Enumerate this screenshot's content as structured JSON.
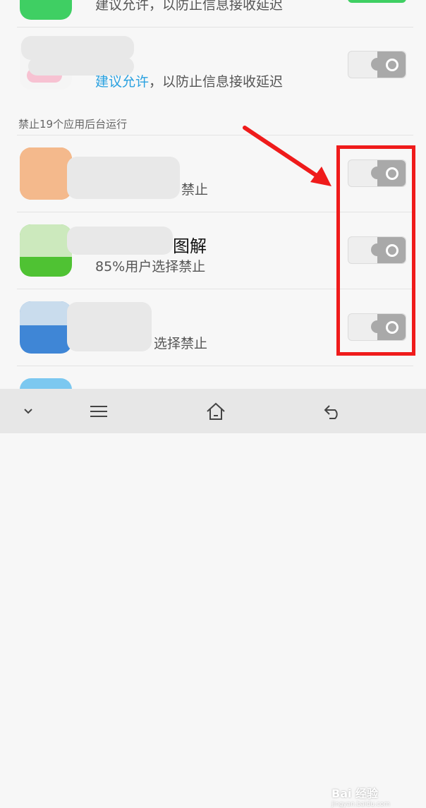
{
  "apps": [
    {
      "subtitle": "建议允许，以防止信息接收延迟",
      "toggle_on": true
    },
    {
      "subtitle_link": "建议允许",
      "subtitle_rest": "，以防止信息接收延迟",
      "toggle_on": false
    }
  ],
  "section": {
    "header": "禁止19个应用后台运行"
  },
  "blocked": [
    {
      "title": "",
      "subtitle": "禁止",
      "toggle_on": false
    },
    {
      "title": "图解",
      "subtitle": "85%用户选择禁止",
      "toggle_on": false
    },
    {
      "title": "",
      "subtitle": "选择禁止",
      "toggle_on": false
    }
  ],
  "navbar": {
    "icons": [
      "chevron-down-icon",
      "menu-icon",
      "home-icon",
      "back-icon"
    ]
  },
  "watermark": {
    "text": "Bai 经验",
    "sub": "jingyan.baidu.com"
  },
  "colors": {
    "accent_link": "#2aa1e0",
    "annotation_red": "#ef1b1b",
    "toggle_knob": "#a9a9a9"
  }
}
